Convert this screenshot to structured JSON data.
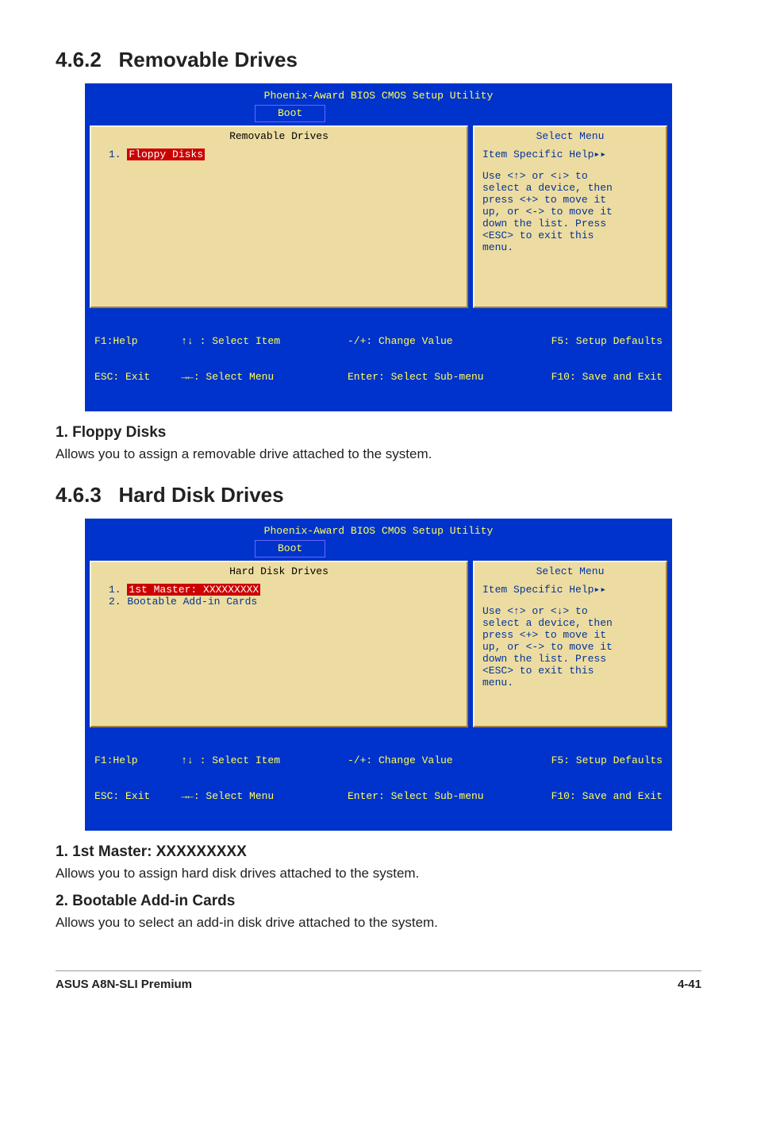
{
  "sections": {
    "s1": {
      "num": "4.6.2",
      "title": "Removable Drives"
    },
    "s2": {
      "num": "4.6.3",
      "title": "Hard Disk Drives"
    }
  },
  "bios1": {
    "title": "Phoenix-Award BIOS CMOS Setup Utility",
    "tab": "Boot",
    "leftHeader": "Removable Drives",
    "items": {
      "i1": {
        "pre": "1. ",
        "label": "Floppy Disks",
        "selected": true
      }
    },
    "rightHeader": "Select Menu",
    "help1": "Item Specific Help▸▸",
    "help2": "Use <↑> or <↓> to",
    "help3": "select a device, then",
    "help4": "press <+> to move it",
    "help5": "up, or <-> to move it",
    "help6": "down the list. Press",
    "help7": "<ESC> to exit this",
    "help8": "menu.",
    "bar1a": "F1:Help       ↑↓ : Select Item",
    "bar1b": "-/+: Change Value",
    "bar1c": "F5: Setup Defaults",
    "bar2a": "ESC: Exit     →←: Select Menu",
    "bar2b": "Enter: Select Sub-menu",
    "bar2c": "F10: Save and Exit"
  },
  "sub1": {
    "head": "1. Floppy Disks",
    "text": "Allows you to assign a removable drive attached to the system."
  },
  "bios2": {
    "title": "Phoenix-Award BIOS CMOS Setup Utility",
    "tab": "Boot",
    "leftHeader": "Hard Disk Drives",
    "items": {
      "i1": {
        "pre": "1. ",
        "label": "1st Master: XXXXXXXXX",
        "selected": true
      },
      "i2": {
        "pre": "2. ",
        "label": "Bootable Add-in Cards",
        "selected": false
      }
    },
    "rightHeader": "Select Menu",
    "help1": "Item Specific Help▸▸",
    "help2": "Use <↑> or <↓> to",
    "help3": "select a device, then",
    "help4": "press <+> to move it",
    "help5": "up, or <-> to move it",
    "help6": "down the list. Press",
    "help7": "<ESC> to exit this",
    "help8": "menu.",
    "bar1a": "F1:Help       ↑↓ : Select Item",
    "bar1b": "-/+: Change Value",
    "bar1c": "F5: Setup Defaults",
    "bar2a": "ESC: Exit     →←: Select Menu",
    "bar2b": "Enter: Select Sub-menu",
    "bar2c": "F10: Save and Exit"
  },
  "sub2": {
    "head": "1. 1st Master: XXXXXXXXX",
    "text": "Allows you to assign hard disk drives attached to the system."
  },
  "sub3": {
    "head": "2. Bootable Add-in Cards",
    "text": "Allows you to select an add-in disk drive attached to the system."
  },
  "footer": {
    "left": "ASUS A8N-SLI Premium",
    "right": "4-41"
  }
}
